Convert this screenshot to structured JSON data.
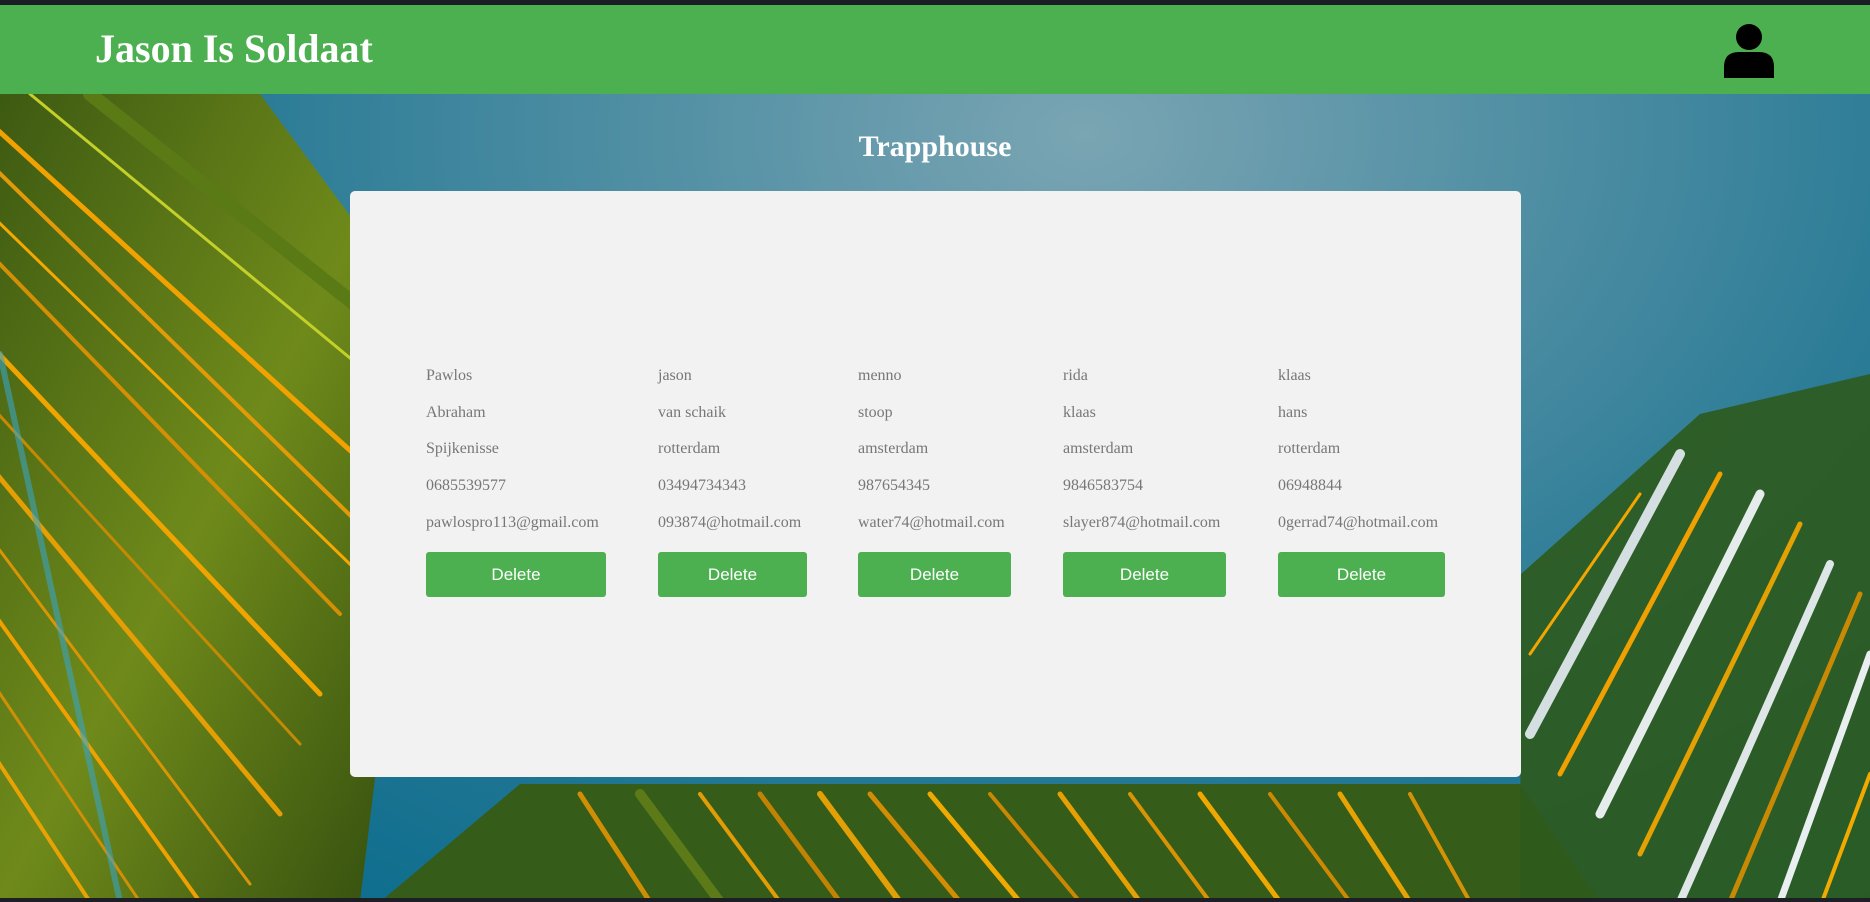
{
  "header": {
    "brand": "Jason Is Soldaat",
    "user_icon": "user-icon"
  },
  "main": {
    "title": "Trapphouse",
    "people": [
      {
        "first_name": "Pawlos",
        "last_name": "Abraham",
        "city": "Spijkenisse",
        "phone": "0685539577",
        "email": "pawlospro113@gmail.com",
        "delete_label": "Delete"
      },
      {
        "first_name": "jason",
        "last_name": "van schaik",
        "city": "rotterdam",
        "phone": "03494734343",
        "email": "093874@hotmail.com",
        "delete_label": "Delete"
      },
      {
        "first_name": "menno",
        "last_name": "stoop",
        "city": "amsterdam",
        "phone": "987654345",
        "email": "water74@hotmail.com",
        "delete_label": "Delete"
      },
      {
        "first_name": "rida",
        "last_name": "klaas",
        "city": "amsterdam",
        "phone": "9846583754",
        "email": "slayer874@hotmail.com",
        "delete_label": "Delete"
      },
      {
        "first_name": "klaas",
        "last_name": "hans",
        "city": "rotterdam",
        "phone": "06948844",
        "email": "0gerrad74@hotmail.com",
        "delete_label": "Delete"
      }
    ]
  },
  "colors": {
    "header_bg": "#4caf50",
    "button_bg": "#4caf50",
    "card_bg": "#f2f2f2",
    "field_text": "#777777"
  }
}
